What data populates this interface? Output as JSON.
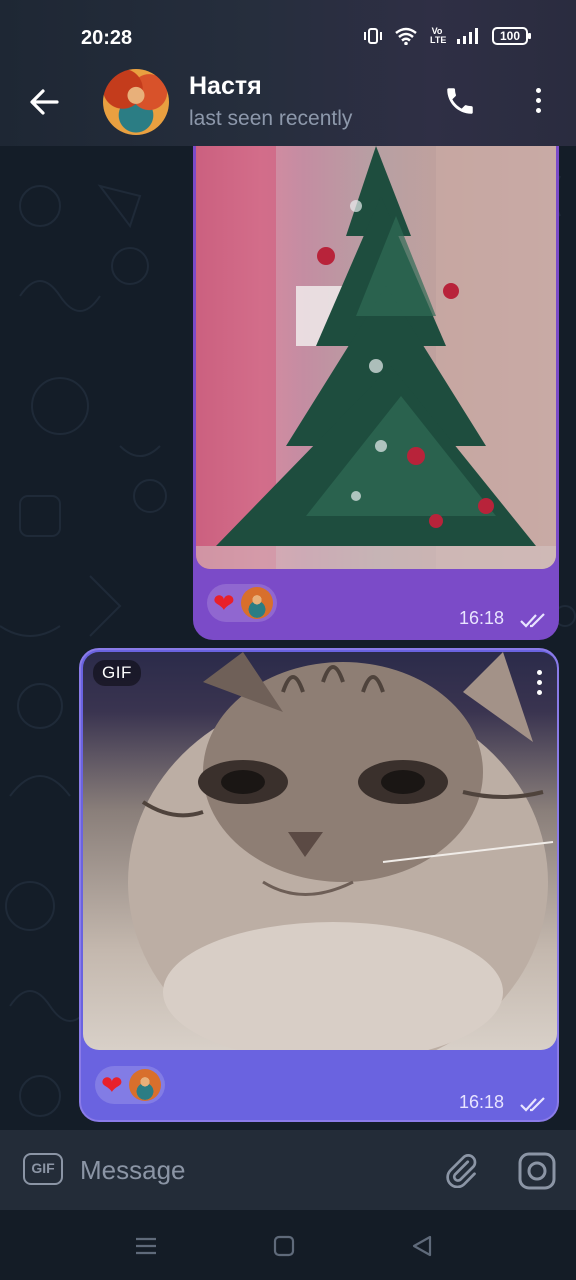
{
  "status_bar": {
    "time": "20:28",
    "battery": "100",
    "network_label": "Vo LTE"
  },
  "header": {
    "contact_name": "Настя",
    "contact_status": "last seen recently",
    "back_icon": "arrow-left-icon",
    "call_icon": "phone-icon",
    "menu_icon": "more-vertical-icon"
  },
  "messages": [
    {
      "type": "image",
      "content": "christmas tree photo",
      "reactions": [
        {
          "emoji": "❤"
        }
      ],
      "time": "16:18",
      "status": "read"
    },
    {
      "type": "gif",
      "badge": "GIF",
      "content": "cat gif",
      "reactions": [
        {
          "emoji": "❤"
        }
      ],
      "time": "16:18",
      "status": "read"
    }
  ],
  "input_bar": {
    "gif_label": "GIF",
    "placeholder": "Message",
    "attach_icon": "paperclip-icon",
    "camera_icon": "camera-icon"
  },
  "nav_bar": {
    "items": [
      "menu-icon",
      "home-square-icon",
      "back-triangle-icon"
    ]
  },
  "colors": {
    "outgoing_bubble_1": "#7b4bc8",
    "outgoing_bubble_2": "#6a63e0",
    "heart": "#e8202a",
    "background": "#141d28"
  }
}
